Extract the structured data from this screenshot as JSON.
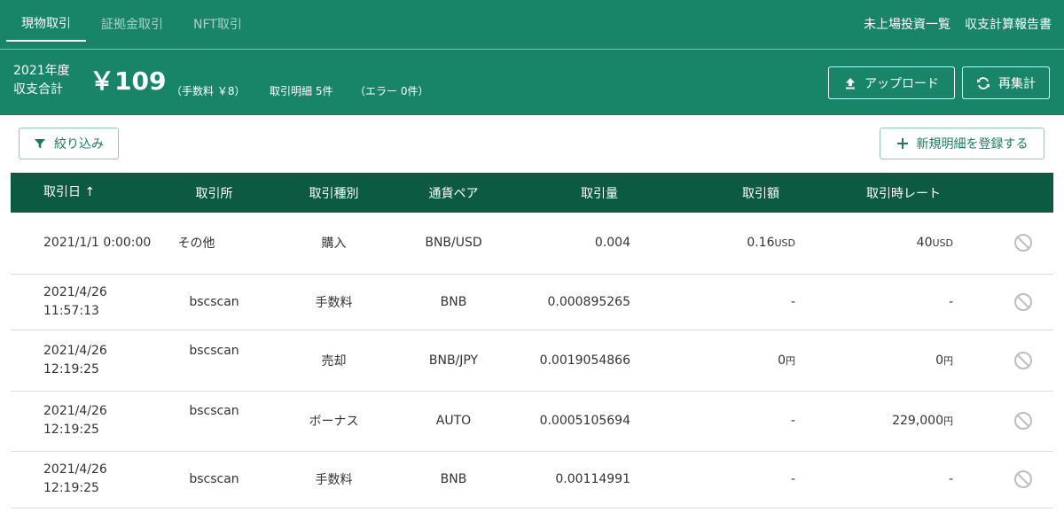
{
  "tabs": [
    {
      "label": "現物取引"
    },
    {
      "label": "証拠金取引"
    },
    {
      "label": "NFT取引"
    }
  ],
  "top_links": {
    "unlisted": "未上場投資一覧",
    "report": "収支計算報告書"
  },
  "summary": {
    "year": "2021年度",
    "label": "収支合計",
    "amount": "￥109",
    "fee": "（手数料 ￥8）",
    "details": "取引明細 5件",
    "errors": "（エラー 0件）"
  },
  "buttons": {
    "upload": "アップロード",
    "recalc": "再集計",
    "filter": "絞り込み",
    "new_entry": "新規明細を登録する"
  },
  "colors": {
    "header_bg": "#198568",
    "table_header_bg": "#0d5a43",
    "accent": "#1b7a5e"
  },
  "table": {
    "headers": {
      "date": "取引日 ↑",
      "exchange": "取引所",
      "type": "取引種別",
      "pair": "通貨ペア",
      "qty": "取引量",
      "amount": "取引額",
      "rate": "取引時レート"
    },
    "rows": [
      {
        "date_line1": "2021/1/1 0:00:00",
        "date_line2": "",
        "exchange": "その他",
        "type": "購入",
        "pair": "BNB/USD",
        "qty": "0.004",
        "amount": "0.16",
        "amount_unit": "USD",
        "rate": "40",
        "rate_unit": "USD"
      },
      {
        "date_line1": "2021/4/26",
        "date_line2": "11:57:13",
        "exchange": "bscscan",
        "type": "手数料",
        "pair": "BNB",
        "qty": "0.000895265",
        "amount": "-",
        "amount_unit": "",
        "rate": "-",
        "rate_unit": ""
      },
      {
        "date_line1": "2021/4/26",
        "date_line2": "12:19:25",
        "exchange": "bscscan",
        "type": "売却",
        "pair": "BNB/JPY",
        "qty": "0.0019054866",
        "amount": "0",
        "amount_unit": "円",
        "rate": "0",
        "rate_unit": "円"
      },
      {
        "date_line1": "2021/4/26",
        "date_line2": "12:19:25",
        "exchange": "bscscan",
        "type": "ボーナス",
        "pair": "AUTO",
        "qty": "0.0005105694",
        "amount": "-",
        "amount_unit": "",
        "rate": "229,000",
        "rate_unit": "円"
      },
      {
        "date_line1": "2021/4/26",
        "date_line2": "12:19:25",
        "exchange": "bscscan",
        "type": "手数料",
        "pair": "BNB",
        "qty": "0.00114991",
        "amount": "-",
        "amount_unit": "",
        "rate": "-",
        "rate_unit": ""
      }
    ]
  }
}
